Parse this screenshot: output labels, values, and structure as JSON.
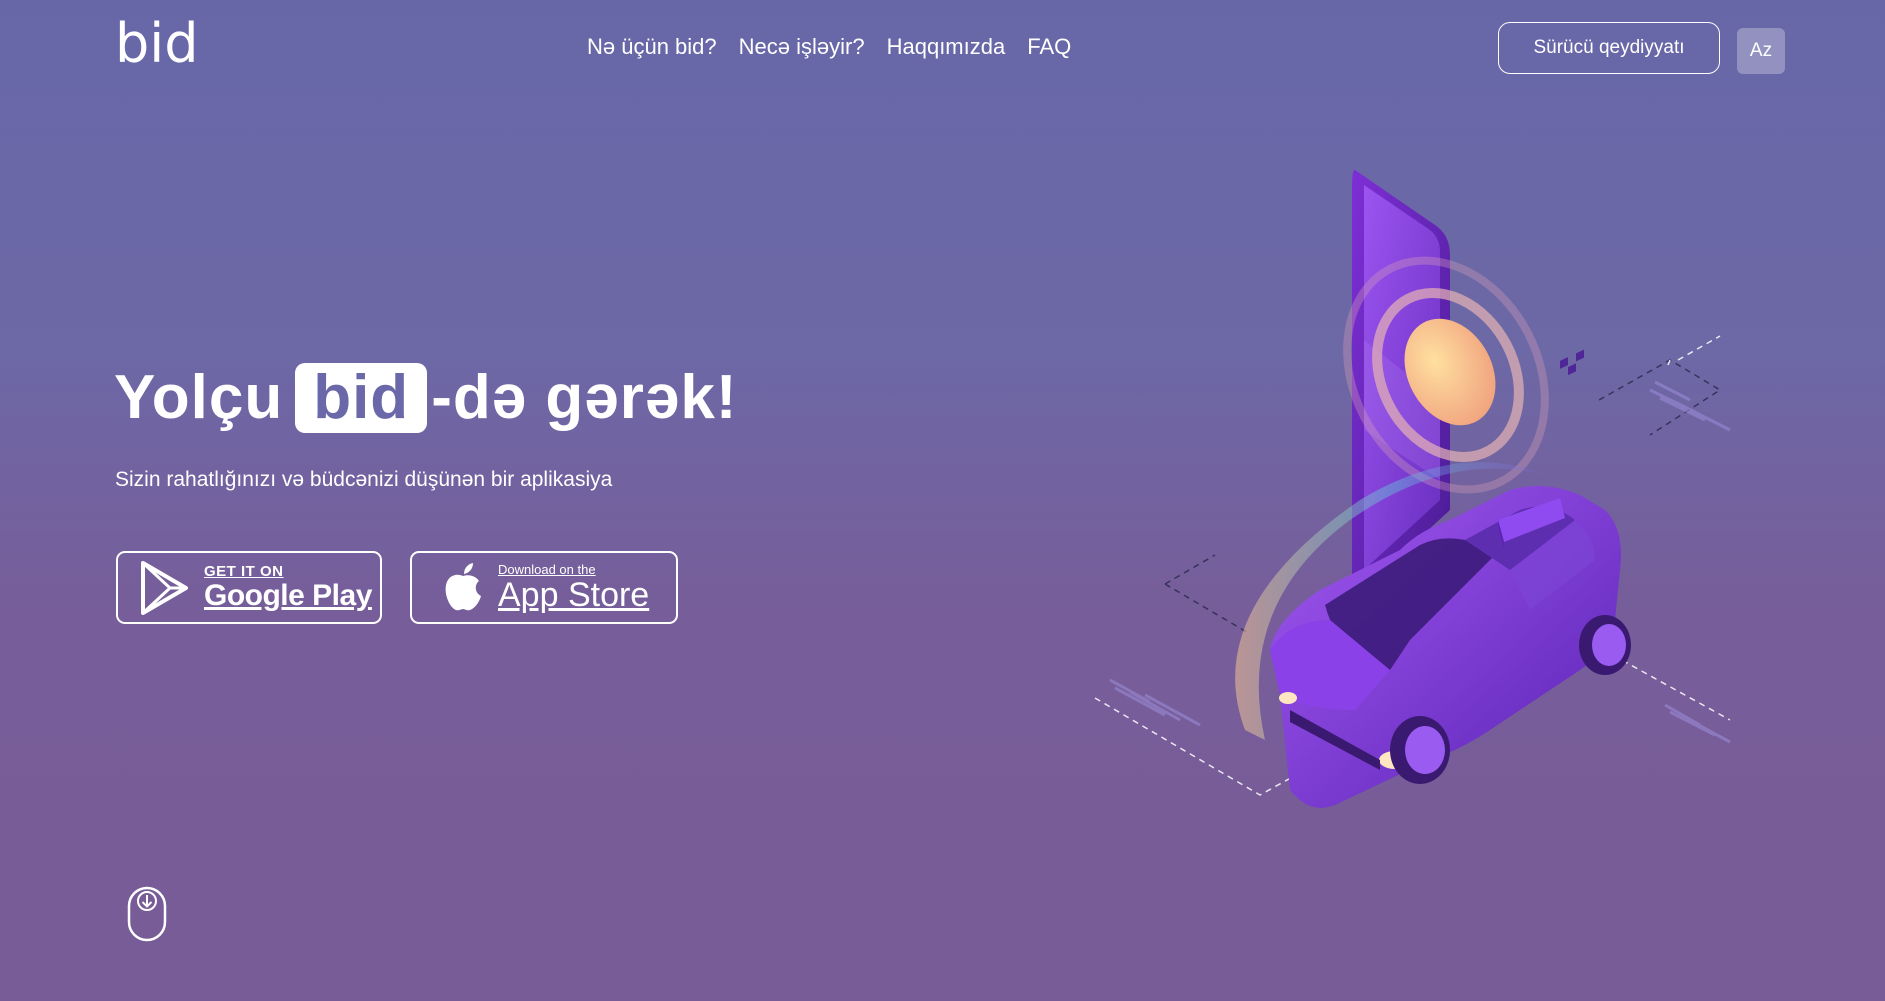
{
  "header": {
    "logo_text": "bid",
    "nav": [
      "Nə üçün bid?",
      "Necə işləyir?",
      "Haqqımızda",
      "FAQ"
    ],
    "driver_button": "Sürücü qeydiyyatı",
    "language": "Az"
  },
  "hero": {
    "title_before": "Yolçu",
    "title_highlight": "bid",
    "title_after": "-də gərək!",
    "subtitle": "Sizin rahatlığınızı və büdcənizi düşünən bir aplikasiya"
  },
  "stores": {
    "google": {
      "small": "GET IT ON",
      "big": "Google Play"
    },
    "apple": {
      "small": "Download on the",
      "big": "App Store"
    }
  },
  "icons": [
    "logo",
    "play-store-icon",
    "apple-icon",
    "mouse-scroll-icon",
    "phone-taxi-illustration"
  ]
}
